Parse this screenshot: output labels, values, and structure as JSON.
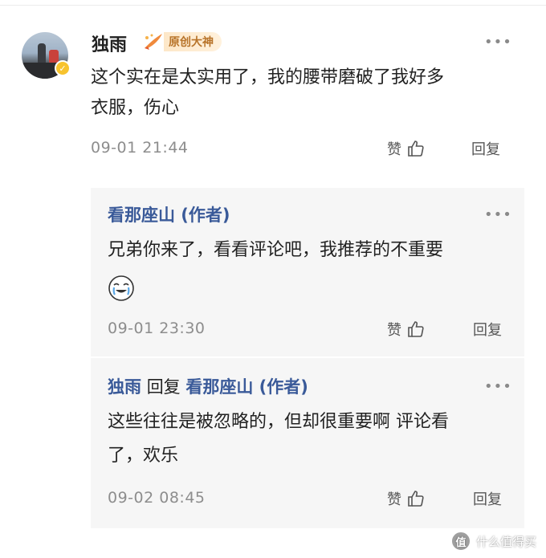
{
  "comment": {
    "username": "独雨",
    "rank_badge": "原创大神",
    "text_line1": "这个实在是太实用了，我的腰带磨破了我好多",
    "text_line2": "衣服，伤心",
    "time": "09-01 21:44",
    "like_label": "赞",
    "reply_label": "回复"
  },
  "replies": [
    {
      "author": "看那座山 (作者)",
      "text_line1": "兄弟你来了，看看评论吧，我推荐的不重要",
      "emoji": "crying-laughing-face",
      "time": "09-01 23:30",
      "like_label": "赞",
      "reply_label": "回复"
    },
    {
      "author": "独雨",
      "reply_word": "回复",
      "target": "看那座山 (作者)",
      "text_line1": "这些往往是被忽略的，但却很重要啊 评论看",
      "text_line2": "了，欢乐",
      "time": "09-02 08:45",
      "like_label": "赞",
      "reply_label": "回复"
    }
  ],
  "more_glyph": "•••",
  "watermark": {
    "logo_char": "值",
    "text": "什么值得买"
  },
  "colors": {
    "author_link": "#3a5a99",
    "reply_bg": "#f6f6f6",
    "badge_text": "#b8742a",
    "meta_gray": "#8d8d8d"
  }
}
